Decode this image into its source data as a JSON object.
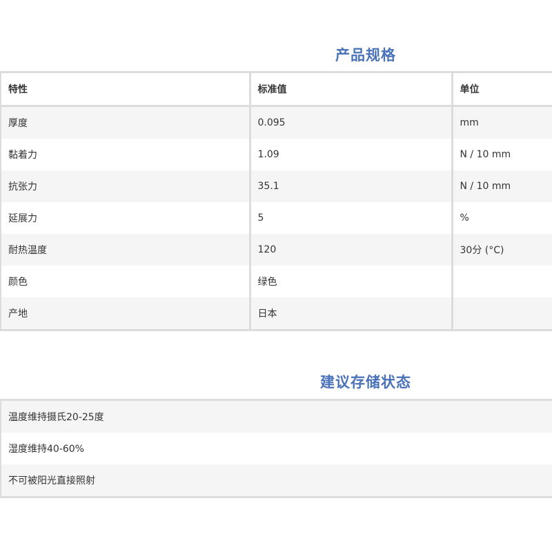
{
  "spec": {
    "title": "产品规格",
    "headers": [
      "特性",
      "标准值",
      "单位"
    ],
    "rows": [
      [
        "厚度",
        "0.095",
        "mm"
      ],
      [
        "黏着力",
        "1.09",
        "N / 10 mm"
      ],
      [
        "抗张力",
        "35.1",
        "N / 10 mm"
      ],
      [
        "延展力",
        "5",
        "%"
      ],
      [
        "耐热温度",
        "120",
        "30分 (°C)"
      ],
      [
        "颜色",
        "绿色",
        ""
      ],
      [
        "产地",
        "日本",
        ""
      ]
    ]
  },
  "storage": {
    "title": "建议存储状态",
    "items": [
      "温度维持摄氏20-25度",
      "湿度维持40-60%",
      "不可被阳光直接照射"
    ]
  },
  "colors": {
    "title": "#4a72b8",
    "border": "#dcdcdc",
    "row_shade": "#f5f5f5"
  }
}
